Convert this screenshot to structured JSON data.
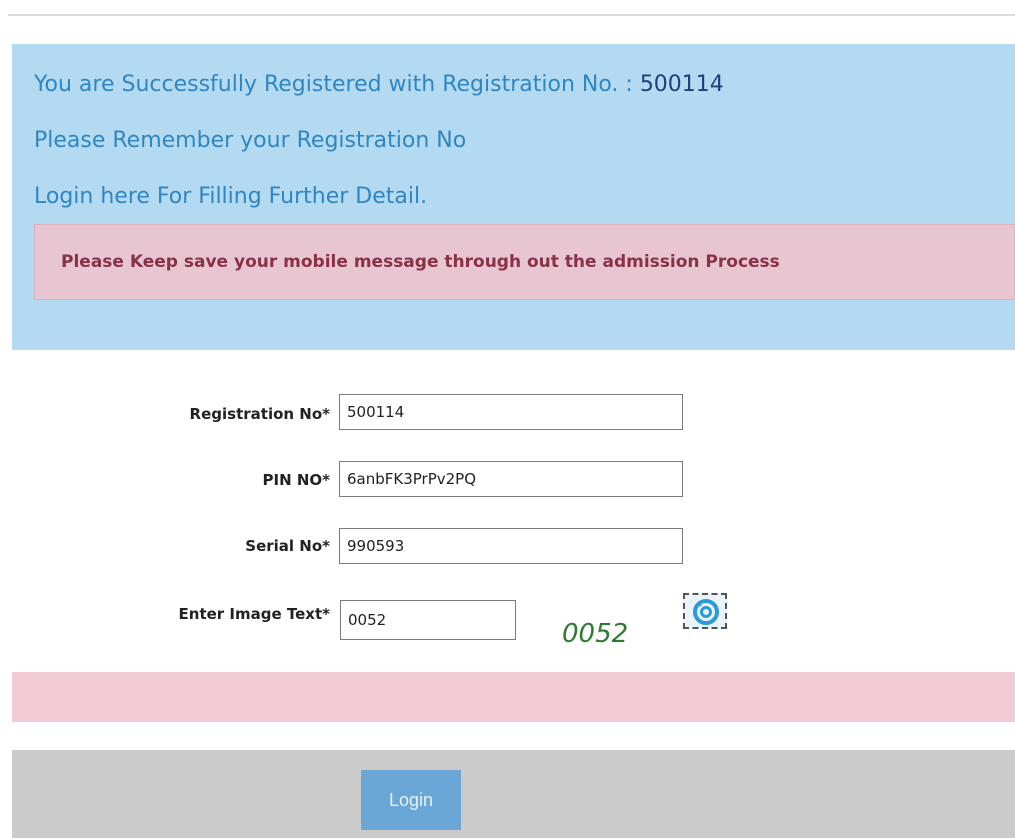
{
  "messages": {
    "success_prefix": "You are Successfully Registered with Registration No. : ",
    "registration_number": "500114",
    "remember": "Please Remember your Registration No",
    "login_hint": "Login here For Filling Further Detail.",
    "warning": "Please Keep save your mobile message through out the admission Process"
  },
  "form": {
    "registration_no": {
      "label": "Registration No*",
      "value": "500114"
    },
    "pin_no": {
      "label": "PIN NO*",
      "value": "6anbFK3PrPv2PQ"
    },
    "serial_no": {
      "label": "Serial No*",
      "value": "990593"
    },
    "image_text": {
      "label": "Enter Image Text*",
      "value": "0052"
    },
    "captcha": "0052",
    "refresh_icon": "refresh-icon"
  },
  "footer": {
    "login_label": "Login"
  },
  "colors": {
    "info_bg": "#b3daf0",
    "info_text": "#2f86c2",
    "warning_bg": "#e8c6d1",
    "warning_text": "#8a3047",
    "error_bg": "#f0cbd3",
    "footer_bg": "#cbcbcb",
    "button_bg": "#6aa6d6",
    "captcha_text": "#2e7a32"
  }
}
